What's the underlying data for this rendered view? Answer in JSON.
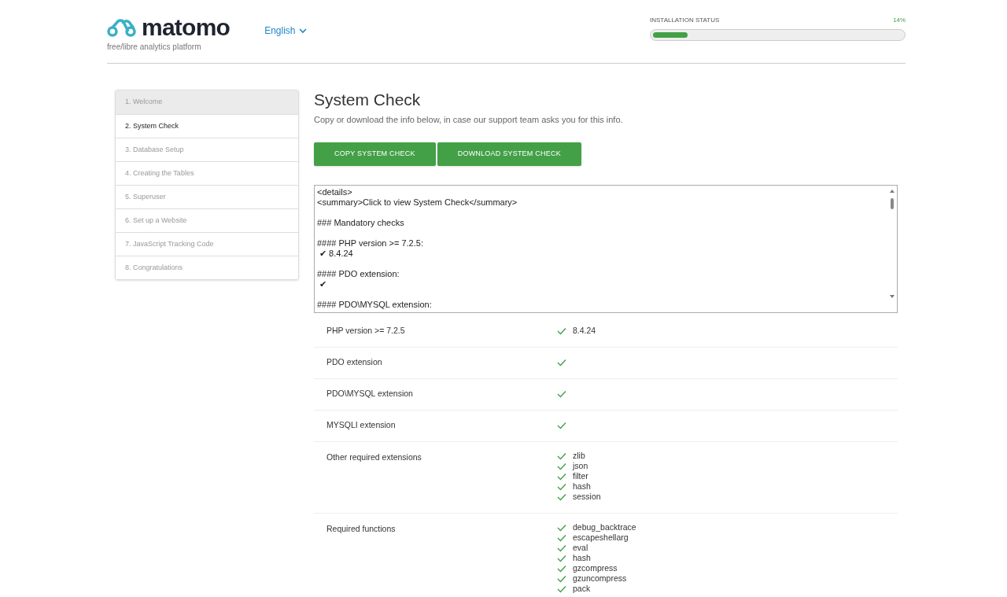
{
  "header": {
    "logo_text": "matomo",
    "tagline": "free/libre analytics platform",
    "language": "English",
    "installation_status": {
      "label": "INSTALLATION STATUS",
      "percent": "14%",
      "level": 0.14
    }
  },
  "steps": [
    {
      "label": "1. Welcome",
      "selected": false,
      "completed": true
    },
    {
      "label": "2. System Check",
      "selected": true,
      "completed": false
    },
    {
      "label": "3. Database Setup",
      "selected": false,
      "completed": false
    },
    {
      "label": "4. Creating the Tables",
      "selected": false,
      "completed": false
    },
    {
      "label": "5. Superuser",
      "selected": false,
      "completed": false
    },
    {
      "label": "6. Set up a Website",
      "selected": false,
      "completed": false
    },
    {
      "label": "7. JavaScript Tracking Code",
      "selected": false,
      "completed": false
    },
    {
      "label": "8. Congratulations",
      "selected": false,
      "completed": false
    }
  ],
  "main": {
    "title": "System Check",
    "description": "Copy or download the info below, in case our support team asks you for this info.",
    "buttons": [
      "COPY SYSTEM CHECK",
      "DOWNLOAD SYSTEM CHECK"
    ],
    "system_check_text": "<details>\n<summary>Click to view System Check</summary>\n\n### Mandatory checks\n\n#### PHP version >= 7.2.5:\n ✔ 8.4.24\n\n#### PDO extension:\n ✔\n\n#### PDO\\MYSQL extension:",
    "checks": [
      {
        "label": "PHP version >= 7.2.5",
        "items": [
          {
            "ok": true,
            "text": "8.4.24"
          }
        ]
      },
      {
        "label": "PDO extension",
        "items": [
          {
            "ok": true
          }
        ]
      },
      {
        "label": "PDO\\MYSQL extension",
        "items": [
          {
            "ok": true
          }
        ]
      },
      {
        "label": "MYSQLI extension",
        "items": [
          {
            "ok": true
          }
        ]
      },
      {
        "label": "Other required extensions",
        "items": [
          {
            "ok": true,
            "text": "zlib"
          },
          {
            "ok": true,
            "text": "json"
          },
          {
            "ok": true,
            "text": "filter"
          },
          {
            "ok": true,
            "text": "hash"
          },
          {
            "ok": true,
            "text": "session"
          }
        ]
      },
      {
        "label": "Required functions",
        "items": [
          {
            "ok": true,
            "text": "debug_backtrace"
          },
          {
            "ok": true,
            "text": "escapeshellarg"
          },
          {
            "ok": true,
            "text": "eval"
          },
          {
            "ok": true,
            "text": "hash"
          },
          {
            "ok": true,
            "text": "gzcompress"
          },
          {
            "ok": true,
            "text": "gzuncompress"
          },
          {
            "ok": true,
            "text": "pack"
          }
        ]
      }
    ]
  }
}
